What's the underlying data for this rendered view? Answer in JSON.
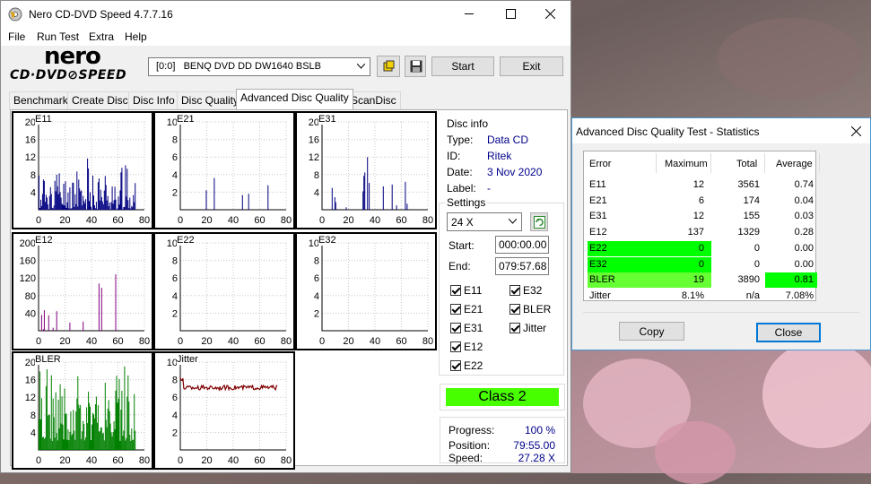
{
  "main": {
    "title": "Nero CD-DVD Speed 4.7.7.16",
    "menu": [
      "File",
      "Run Test",
      "Extra",
      "Help"
    ],
    "logo_top": "nero",
    "logo_bottom": "CD·DVD⊘SPEED",
    "drive": "[0:0]   BENQ DVD DD DW1640 BSLB",
    "start_label": "Start",
    "exit_label": "Exit",
    "tabs": [
      "Benchmark",
      "Create Disc",
      "Disc Info",
      "Disc Quality",
      "Advanced Disc Quality",
      "ScanDisc"
    ],
    "active_tab": 4
  },
  "disc_info": {
    "group_label": "Disc info",
    "type_label": "Type:",
    "type_value": "Data CD",
    "id_label": "ID:",
    "id_value": "Ritek",
    "date_label": "Date:",
    "date_value": "3 Nov 2020",
    "label_label": "Label:",
    "label_value": "-"
  },
  "settings": {
    "group_label": "Settings",
    "speed": "24 X",
    "start_label": "Start:",
    "start_value": "000:00.00",
    "end_label": "End:",
    "end_value": "079:57.68",
    "checkboxes_left": [
      "E11",
      "E21",
      "E31",
      "E12",
      "E22"
    ],
    "checkboxes_right": [
      "E32",
      "BLER",
      "Jitter"
    ]
  },
  "class_label": "Class 2",
  "progress": {
    "progress_label": "Progress:",
    "progress_value": "100 %",
    "position_label": "Position:",
    "position_value": "79:55.00",
    "speed_label": "Speed:",
    "speed_value": "27.28 X"
  },
  "graphs": [
    {
      "name": "E11",
      "yticks": [
        "20",
        "16",
        "12",
        "8",
        "4"
      ],
      "ymax": 20,
      "xticks": [
        "0",
        "20",
        "40",
        "60",
        "80"
      ],
      "color": "#000080"
    },
    {
      "name": "E21",
      "yticks": [
        "10",
        "8",
        "6",
        "4",
        "2"
      ],
      "ymax": 10,
      "xticks": [
        "0",
        "20",
        "40",
        "60",
        "80"
      ],
      "color": "#000080"
    },
    {
      "name": "E31",
      "yticks": [
        "20",
        "16",
        "12",
        "8",
        "4"
      ],
      "ymax": 20,
      "xticks": [
        "0",
        "20",
        "40",
        "60",
        "80"
      ],
      "color": "#000080"
    },
    {
      "name": "E12",
      "yticks": [
        "200",
        "160",
        "120",
        "80",
        "40"
      ],
      "ymax": 200,
      "xticks": [
        "0",
        "20",
        "40",
        "60",
        "80"
      ],
      "color": "#800080"
    },
    {
      "name": "E22",
      "yticks": [
        "10",
        "8",
        "6",
        "4",
        "2"
      ],
      "ymax": 10,
      "xticks": [
        "0",
        "20",
        "40",
        "60",
        "80"
      ],
      "color": "#800080"
    },
    {
      "name": "E32",
      "yticks": [
        "10",
        "8",
        "6",
        "4",
        "2"
      ],
      "ymax": 10,
      "xticks": [
        "0",
        "20",
        "40",
        "60",
        "80"
      ],
      "color": "#800080"
    },
    {
      "name": "BLER",
      "yticks": [
        "20",
        "16",
        "12",
        "8",
        "4"
      ],
      "ymax": 20,
      "xticks": [
        "0",
        "20",
        "40",
        "60",
        "80"
      ],
      "color": "#008000"
    },
    {
      "name": "Jitter",
      "yticks": [
        "10",
        "8",
        "6",
        "4",
        "2"
      ],
      "ymax": 10,
      "xticks": [
        "0",
        "20",
        "40",
        "60",
        "80"
      ],
      "color": "#800000"
    }
  ],
  "stats": {
    "title": "Advanced Disc Quality Test - Statistics",
    "headers": [
      "Error",
      "Maximum",
      "Total",
      "Average"
    ],
    "rows": [
      {
        "error": "E11",
        "max": "12",
        "total": "3561",
        "avg": "0.74",
        "hl_err": false,
        "hl_avg": false
      },
      {
        "error": "E21",
        "max": "6",
        "total": "174",
        "avg": "0.04",
        "hl_err": false,
        "hl_avg": false
      },
      {
        "error": "E31",
        "max": "12",
        "total": "155",
        "avg": "0.03",
        "hl_err": false,
        "hl_avg": false
      },
      {
        "error": "E12",
        "max": "137",
        "total": "1329",
        "avg": "0.28",
        "hl_err": false,
        "hl_avg": false
      },
      {
        "error": "E22",
        "max": "0",
        "total": "0",
        "avg": "0.00",
        "hl_err": true,
        "hl_avg": false
      },
      {
        "error": "E32",
        "max": "0",
        "total": "0",
        "avg": "0.00",
        "hl_err": true,
        "hl_avg": false
      },
      {
        "error": "BLER",
        "max": "19",
        "total": "3890",
        "avg": "0.81",
        "hl_err": true,
        "hl_avg": true
      },
      {
        "error": "Jitter",
        "max": "8.1%",
        "total": "n/a",
        "avg": "7.08%",
        "hl_err": false,
        "hl_avg": false
      }
    ],
    "copy_label": "Copy",
    "close_label": "Close"
  },
  "colors": {
    "class_green": "#48ff00",
    "highlight_green": "#00ff00",
    "highlight_bler": "#66ff33",
    "accent": "#0078d7"
  }
}
